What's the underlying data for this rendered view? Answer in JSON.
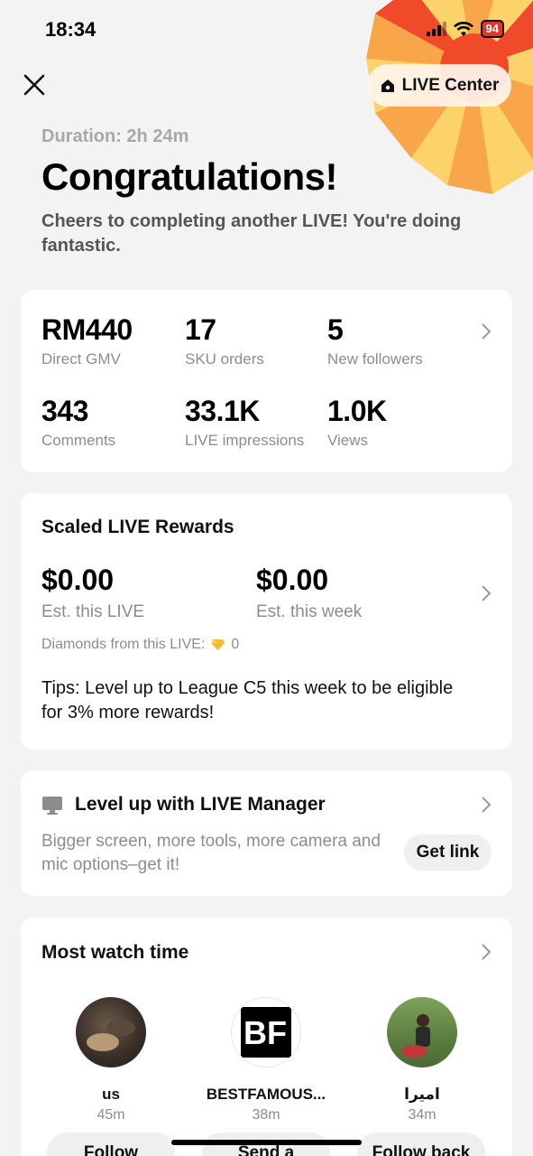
{
  "status_bar": {
    "time": "18:34",
    "battery": "94"
  },
  "header": {
    "live_center_label": "LIVE Center",
    "duration": "Duration: 2h 24m",
    "title": "Congratulations!",
    "subtitle": "Cheers to completing another LIVE! You're doing fantastic."
  },
  "stats": [
    {
      "value": "RM440",
      "label": "Direct GMV"
    },
    {
      "value": "17",
      "label": "SKU orders"
    },
    {
      "value": "5",
      "label": "New followers"
    },
    {
      "value": "343",
      "label": "Comments"
    },
    {
      "value": "33.1K",
      "label": "LIVE impressions"
    },
    {
      "value": "1.0K",
      "label": "Views"
    }
  ],
  "rewards": {
    "title": "Scaled LIVE Rewards",
    "this_live_value": "$0.00",
    "this_live_label": "Est. this LIVE",
    "this_week_value": "$0.00",
    "this_week_label": "Est. this week",
    "diamonds_label": "Diamonds from this LIVE:",
    "diamonds_value": "0",
    "tips": "Tips: Level up to League C5 this week to be eligible for 3% more rewards!"
  },
  "manager": {
    "title": "Level up with LIVE Manager",
    "description": "Bigger screen, more tools, more camera and mic options–get it!",
    "button": "Get link"
  },
  "watch_time": {
    "title": "Most watch time",
    "viewers": [
      {
        "name": "us",
        "time": "45m",
        "button": "Follow"
      },
      {
        "name": "BESTFAMOUS...",
        "time": "38m",
        "button": "Send a"
      },
      {
        "name": "اميرا",
        "time": "34m",
        "button": "Follow back"
      }
    ]
  },
  "colors": {
    "accent_red": "#e0352b",
    "burst_orange": "#f9a54a",
    "burst_yellow": "#fcd36a"
  }
}
